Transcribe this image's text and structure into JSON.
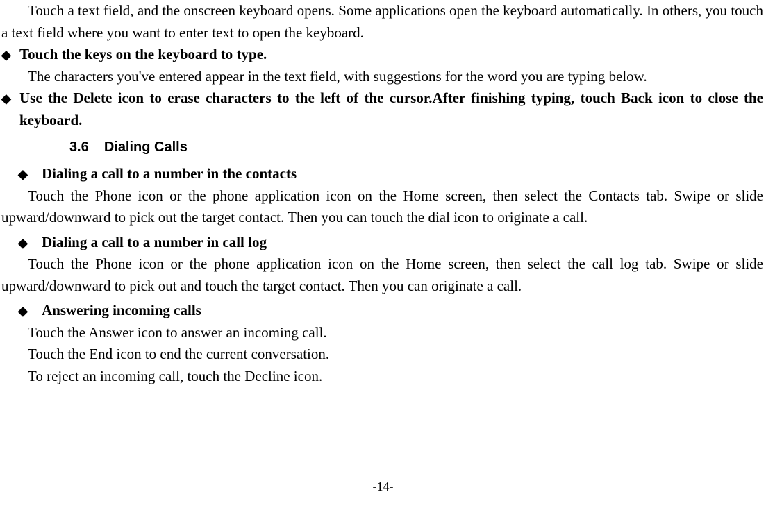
{
  "intro_para": "Touch a text field, and the onscreen keyboard opens. Some applications open the keyboard automatically. In others, you touch a text field where you want to enter text to open the keyboard.",
  "bullets_top": [
    {
      "title": "Touch the keys on the keyboard to type.",
      "body": "The characters you've entered appear in the text field, with suggestions for the word you are typing below."
    },
    {
      "title": "Use the Delete icon to erase characters to the left of the cursor.After finishing typing, touch Back icon to close the keyboard.",
      "body": ""
    }
  ],
  "section": {
    "number": "3.6",
    "title": "Dialing Calls"
  },
  "sub_sections": [
    {
      "title": "Dialing a call to a number in the contacts",
      "body": "Touch the Phone icon or the phone application icon on the Home screen, then select the Contacts tab. Swipe or slide upward/downward to pick out the target contact. Then you can touch the dial icon to originate a call."
    },
    {
      "title": "Dialing a call to a number in call log",
      "body": "Touch the Phone icon or the phone application icon on the Home screen, then select the call log tab. Swipe or slide upward/downward to pick out and touch the target contact. Then you can originate a call."
    },
    {
      "title": "Answering incoming calls",
      "body_lines": [
        "Touch the Answer icon to answer an incoming call.",
        "Touch the End icon to end the current conversation.",
        "To reject an incoming call, touch the Decline icon."
      ]
    }
  ],
  "page_number": "-14-"
}
